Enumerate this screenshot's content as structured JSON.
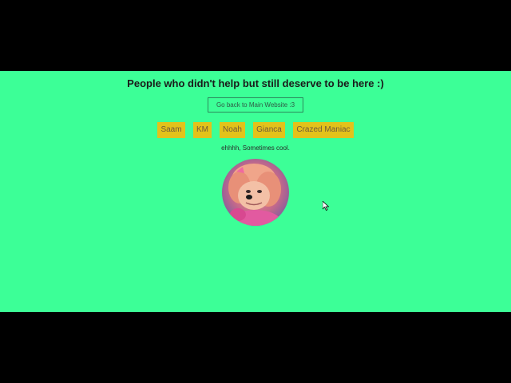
{
  "colors": {
    "background": "#3cff97",
    "chip_background": "#e3c21a",
    "chip_text": "#6e5a3a",
    "letterbox": "#000000"
  },
  "page": {
    "title": "People who didn't help but still deserve to be here :)",
    "back_button_label": "Go back to Main Website :3",
    "caption": "ehhhh, Sometimes cool."
  },
  "people": [
    {
      "label": "Saam"
    },
    {
      "label": "KM"
    },
    {
      "label": "Noah"
    },
    {
      "label": "Gianca"
    },
    {
      "label": "Crazed Maniac"
    }
  ],
  "icons": {
    "avatar": "cartoon-dog-avatar",
    "cursor": "mouse-pointer-icon"
  }
}
